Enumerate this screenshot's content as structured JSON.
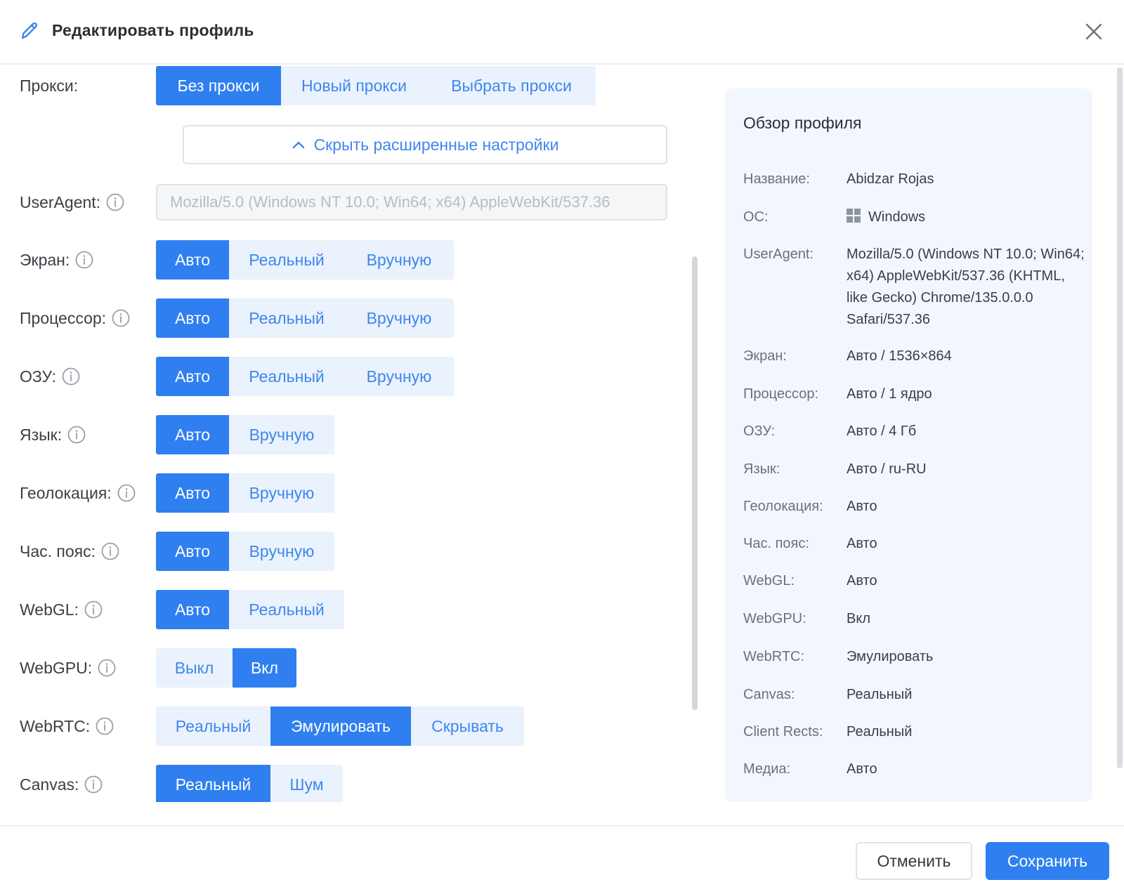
{
  "header": {
    "title": "Редактировать профиль"
  },
  "proxy": {
    "label": "Прокси:",
    "options": [
      "Без прокси",
      "Новый прокси",
      "Выбрать прокси"
    ]
  },
  "advanced_toggle": "Скрыть расширенные настройки",
  "useragent": {
    "label": "UserAgent:",
    "value": "Mozilla/5.0 (Windows NT 10.0; Win64; x64) AppleWebKit/537.36"
  },
  "settings": {
    "screen": {
      "label": "Экран:",
      "options": [
        "Авто",
        "Реальный",
        "Вручную"
      ]
    },
    "cpu": {
      "label": "Процессор:",
      "options": [
        "Авто",
        "Реальный",
        "Вручную"
      ]
    },
    "ram": {
      "label": "ОЗУ:",
      "options": [
        "Авто",
        "Реальный",
        "Вручную"
      ]
    },
    "language": {
      "label": "Язык:",
      "options": [
        "Авто",
        "Вручную"
      ]
    },
    "geo": {
      "label": "Геолокация:",
      "options": [
        "Авто",
        "Вручную"
      ]
    },
    "timezone": {
      "label": "Час. пояс:",
      "options": [
        "Авто",
        "Вручную"
      ]
    },
    "webgl": {
      "label": "WebGL:",
      "options": [
        "Авто",
        "Реальный"
      ]
    },
    "webgpu": {
      "label": "WebGPU:",
      "options": [
        "Выкл",
        "Вкл"
      ]
    },
    "webrtc": {
      "label": "WebRTC:",
      "options": [
        "Реальный",
        "Эмулировать",
        "Скрывать"
      ]
    },
    "canvas": {
      "label": "Canvas:",
      "options": [
        "Реальный",
        "Шум"
      ]
    }
  },
  "overview": {
    "title": "Обзор профиля",
    "rows": [
      {
        "key": "Название:",
        "value": "Abidzar Rojas"
      },
      {
        "key": "ОС:",
        "value": "Windows"
      },
      {
        "key": "UserAgent:",
        "value": "Mozilla/5.0 (Windows NT 10.0; Win64; x64) AppleWebKit/537.36 (KHTML, like Gecko) Chrome/135.0.0.0 Safari/537.36"
      },
      {
        "key": "Экран:",
        "value": "Авто / 1536×864"
      },
      {
        "key": "Процессор:",
        "value": "Авто / 1 ядро"
      },
      {
        "key": "ОЗУ:",
        "value": "Авто / 4 Гб"
      },
      {
        "key": "Язык:",
        "value": "Авто / ru-RU"
      },
      {
        "key": "Геолокация:",
        "value": "Авто"
      },
      {
        "key": "Час. пояс:",
        "value": "Авто"
      },
      {
        "key": "WebGL:",
        "value": "Авто"
      },
      {
        "key": "WebGPU:",
        "value": "Вкл"
      },
      {
        "key": "WebRTC:",
        "value": "Эмулировать"
      },
      {
        "key": "Canvas:",
        "value": "Реальный"
      },
      {
        "key": "Client Rects:",
        "value": "Реальный"
      },
      {
        "key": "Медиа:",
        "value": "Авто"
      }
    ]
  },
  "footer": {
    "cancel": "Отменить",
    "save": "Сохранить"
  },
  "colors": {
    "accent": "#2f7ff0",
    "accent_light": "#eaf2fd",
    "panel_bg": "#f2f7fd"
  }
}
